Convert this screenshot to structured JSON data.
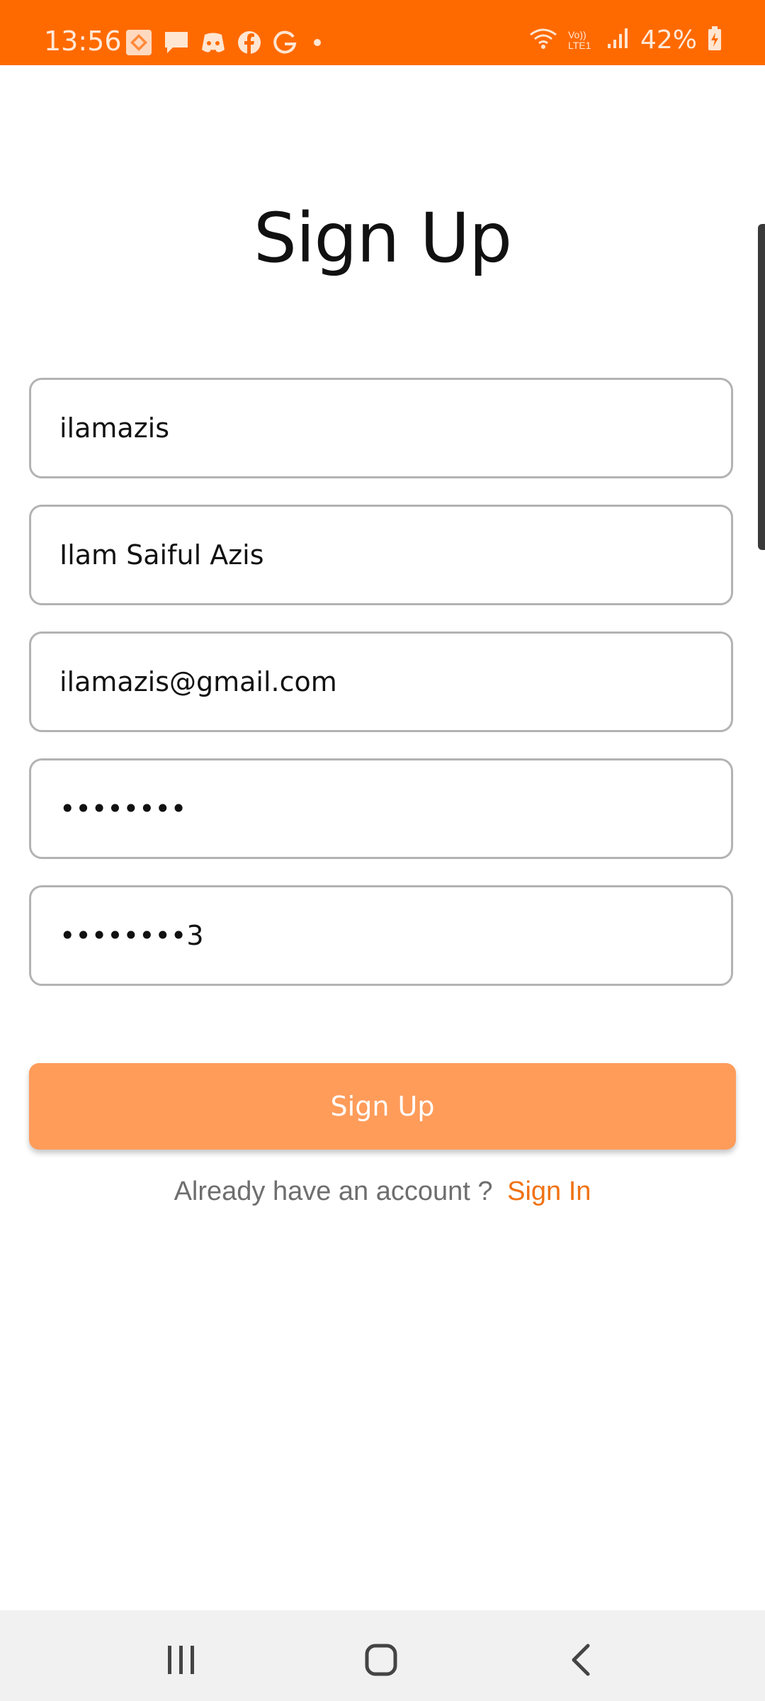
{
  "status_bar": {
    "time": "13:56",
    "notification_icons": [
      "game-icon",
      "message-icon",
      "discord-icon",
      "facebook-icon",
      "google-icon",
      "dot-icon"
    ],
    "battery": "42%",
    "network": "Vo)) LTE1",
    "background": "#ff6a00"
  },
  "page": {
    "title": "Sign Up"
  },
  "form": {
    "username": "ilamazis",
    "full_name": "Ilam Saiful Azis",
    "email": "ilamazis@gmail.com",
    "password": "••••••••",
    "confirm_password": "••••••••3"
  },
  "actions": {
    "signup_label": "Sign Up",
    "signup_color": "#ff9c5a",
    "signin_prompt": "Already have an account ?",
    "signin_link": "Sign In",
    "signin_color": "#f07214"
  },
  "nav_bar": {
    "buttons": [
      "recents-icon",
      "home-icon",
      "back-icon"
    ]
  }
}
